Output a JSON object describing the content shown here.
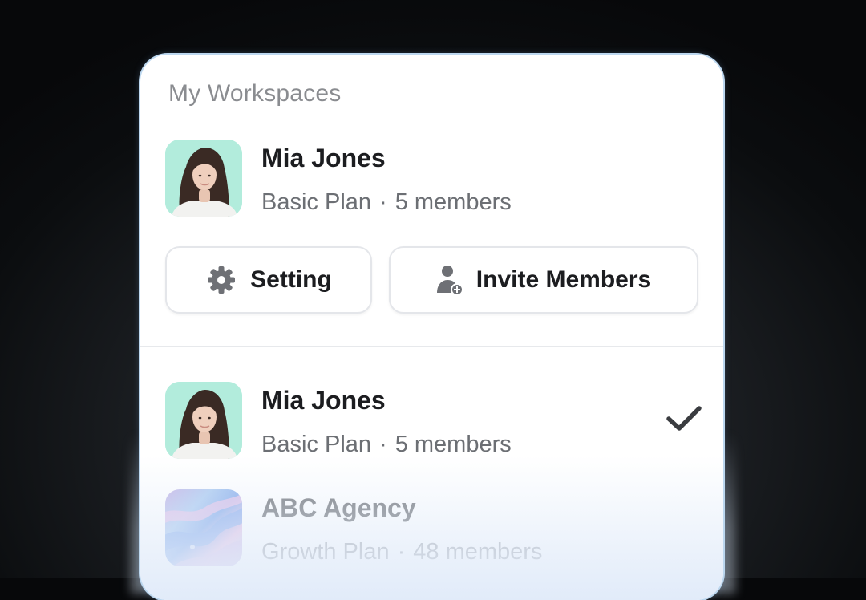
{
  "workspace_panel": {
    "title": "My Workspaces",
    "current": {
      "name": "Mia Jones",
      "plan": "Basic Plan",
      "separator": "·",
      "members": "5 members",
      "avatar_icon": "profile-photo"
    },
    "actions": {
      "setting_label": "Setting",
      "setting_icon": "gear-icon",
      "invite_label": "Invite Members",
      "invite_icon": "add-user-icon"
    },
    "list": [
      {
        "name": "Mia Jones",
        "plan": "Basic Plan",
        "separator": "·",
        "members": "5 members",
        "selected": true,
        "avatar_icon": "profile-photo"
      },
      {
        "name": "ABC Agency",
        "plan": "Growth Plan",
        "separator": "·",
        "members": "48 members",
        "selected": false,
        "avatar_icon": "abstract-art"
      }
    ]
  },
  "colors": {
    "panel_border": "#bcd7ef",
    "avatar_background": "#a6ead8",
    "text_primary": "#1c1d20",
    "text_secondary": "#6c6f74"
  }
}
